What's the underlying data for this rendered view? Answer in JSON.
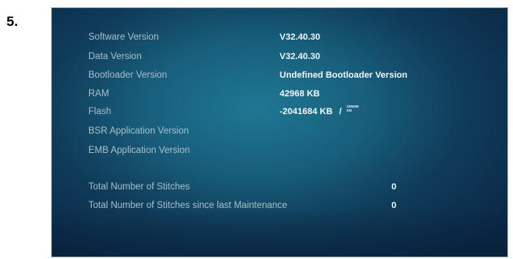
{
  "step": {
    "number": "5."
  },
  "info": {
    "software_version": {
      "label": "Software Version",
      "value": "V32.40.30"
    },
    "data_version": {
      "label": "Data Version",
      "value": "V32.40.30"
    },
    "bootloader_version": {
      "label": "Bootloader Version",
      "value": "Undefined Bootloader Version"
    },
    "ram": {
      "label": "RAM",
      "value": "42968 KB"
    },
    "flash": {
      "label": "Flash",
      "value": "-2041684 KB",
      "separator": "/",
      "total_top": "180608",
      "total_bottom": "KB"
    },
    "bsr_application_version": {
      "label": "BSR Application Version"
    },
    "emb_application_version": {
      "label": "EMB Application Version"
    }
  },
  "stitches": {
    "total": {
      "label": "Total Number of Stitches",
      "value": "0"
    },
    "since_maintenance": {
      "label": "Total Number of Stitches since last Maintenance",
      "value": "0"
    }
  }
}
